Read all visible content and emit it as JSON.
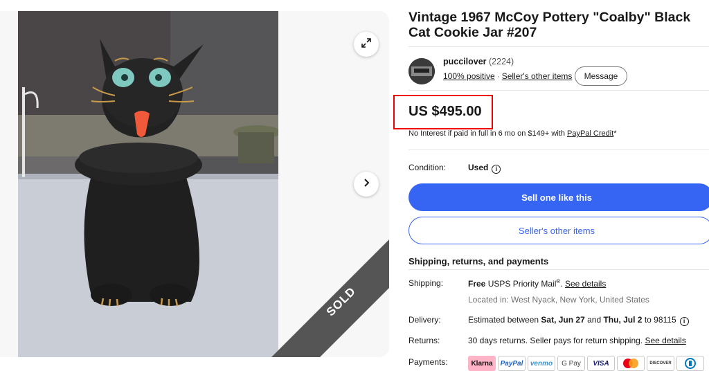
{
  "listing": {
    "title": "Vintage 1967 McCoy Pottery \"Coalby\" Black Cat Cookie Jar #207",
    "sold_label": "SOLD",
    "price": "US $495.00",
    "credit_prefix": "No Interest if paid in full in 6 mo on $149+ with ",
    "credit_link": "PayPal Credit",
    "credit_suffix": "*",
    "condition_label": "Condition:",
    "condition_value": "Used"
  },
  "seller": {
    "name": "puccilover",
    "count": "(2224)",
    "positive": "100% positive",
    "other_items": "Seller's other items",
    "message_button": "Message"
  },
  "actions": {
    "primary": "Sell one like this",
    "secondary": "Seller's other items"
  },
  "shipping": {
    "heading": "Shipping, returns, and payments",
    "shipping_label": "Shipping:",
    "shipping_free": "Free",
    "shipping_service": " USPS Priority Mail",
    "shipping_reg": "®",
    "shipping_link": "See details",
    "location": "Located in: West Nyack, New York, United States",
    "delivery_label": "Delivery:",
    "delivery_prefix": "Estimated between ",
    "delivery_start": "Sat, Jun 27",
    "delivery_and": " and ",
    "delivery_end": "Thu, Jul 2",
    "delivery_suffix": " to 98115",
    "returns_label": "Returns:",
    "returns_text": "30 days returns. Seller pays for return shipping. ",
    "returns_link": "See details",
    "payments_label": "Payments:"
  },
  "payments": [
    "Klarna",
    "PayPal",
    "venmo",
    "G Pay",
    "VISA",
    "",
    "DISCOVER",
    ""
  ],
  "colors": {
    "accent": "#3665f3",
    "highlight_box": "#ee0000",
    "sold_ribbon": "#555555"
  },
  "icons": {
    "expand": "expand-icon",
    "next": "chevron-right-icon",
    "info": "info-icon"
  }
}
